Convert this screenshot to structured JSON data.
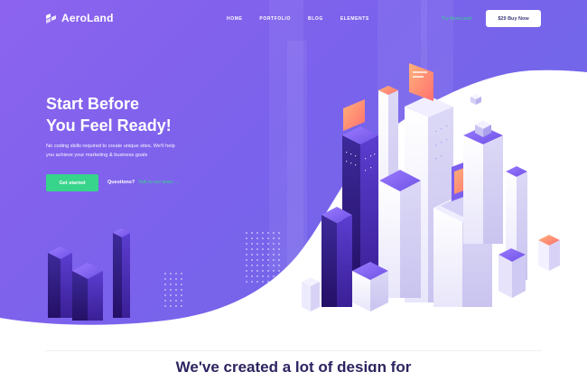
{
  "nav": {
    "brand": "AeroLand",
    "links": [
      "HOME",
      "PORTFOLIO",
      "BLOG",
      "ELEMENTS"
    ],
    "signin": "Try AeroLand",
    "buy_label": "$29 Buy Now"
  },
  "hero": {
    "headline_line1": "Start Before",
    "headline_line2": "You Feel Ready!",
    "subtext_line1": "No coding skills required to create unique sites. We'll help",
    "subtext_line2": "you achieve your marketing & business goals",
    "cta_label": "Get started",
    "question_label": "Questions?",
    "question_link": "Talk to our team →"
  },
  "section": {
    "heading": "We've created a lot of design for"
  },
  "colors": {
    "hero_gradient_start": "#8c63ee",
    "hero_gradient_end": "#6c6be6",
    "accent_green": "#37d48b",
    "heading_dark": "#2b2560"
  },
  "icons": [
    "logo-mark-icon",
    "city-illustration"
  ]
}
